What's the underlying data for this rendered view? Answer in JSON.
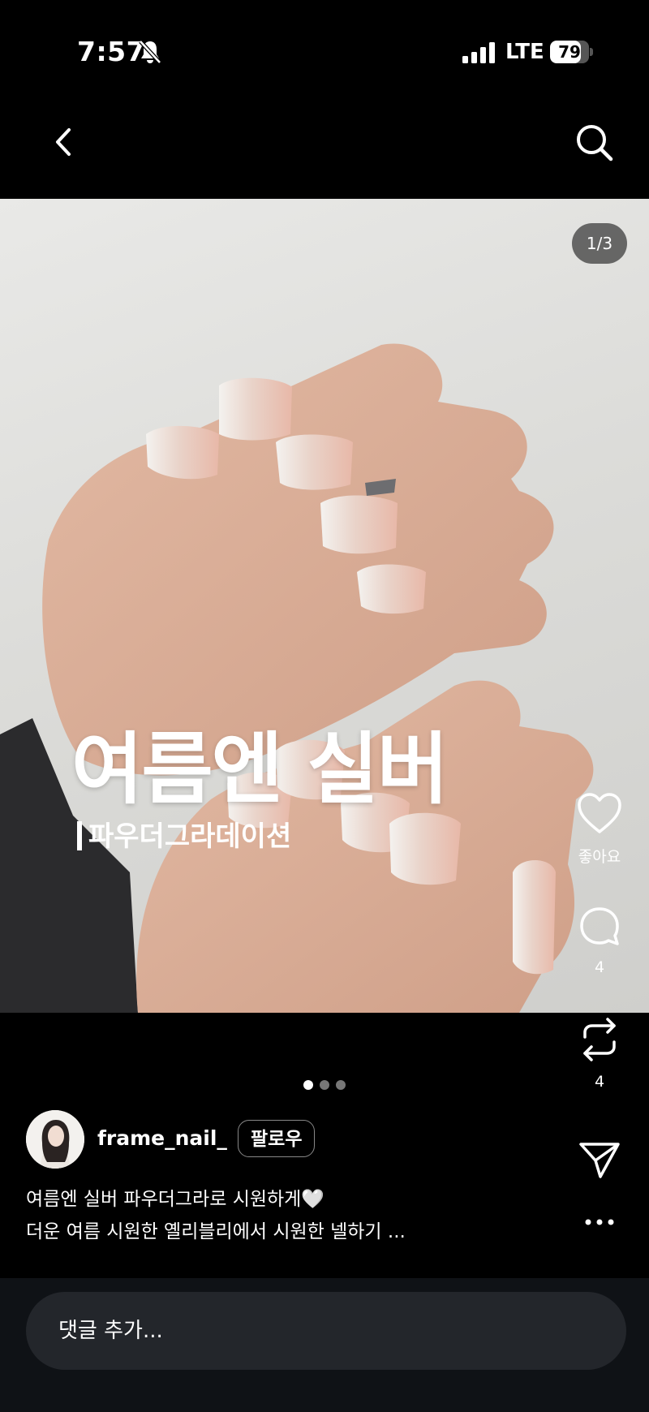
{
  "status_bar": {
    "time": "7:57",
    "network": "LTE",
    "battery": "79",
    "battery_level": 0.79
  },
  "post": {
    "image_counter": "1/3",
    "overlay_title": "여름엔 실버",
    "overlay_subtitle": "파우더그라데이션",
    "total_images": 3,
    "current_image": 1
  },
  "actions": {
    "like_label": "좋아요",
    "comment_count": "4",
    "repost_count": "4"
  },
  "author": {
    "username": "frame_nail_",
    "follow_label": "팔로우"
  },
  "caption": {
    "line1": "여름엔 실버 파우더그라로 시원하게🤍",
    "line2": "더운 여름 시원한 옐리블리에서 시원한 넬하기 ..."
  },
  "comment": {
    "placeholder": "댓글 추가..."
  },
  "icons": [
    "bell-muted-icon",
    "signal-icon",
    "battery-icon",
    "back-arrow-icon",
    "search-icon",
    "heart-icon",
    "comment-icon",
    "repost-icon",
    "share-icon",
    "more-icon"
  ]
}
